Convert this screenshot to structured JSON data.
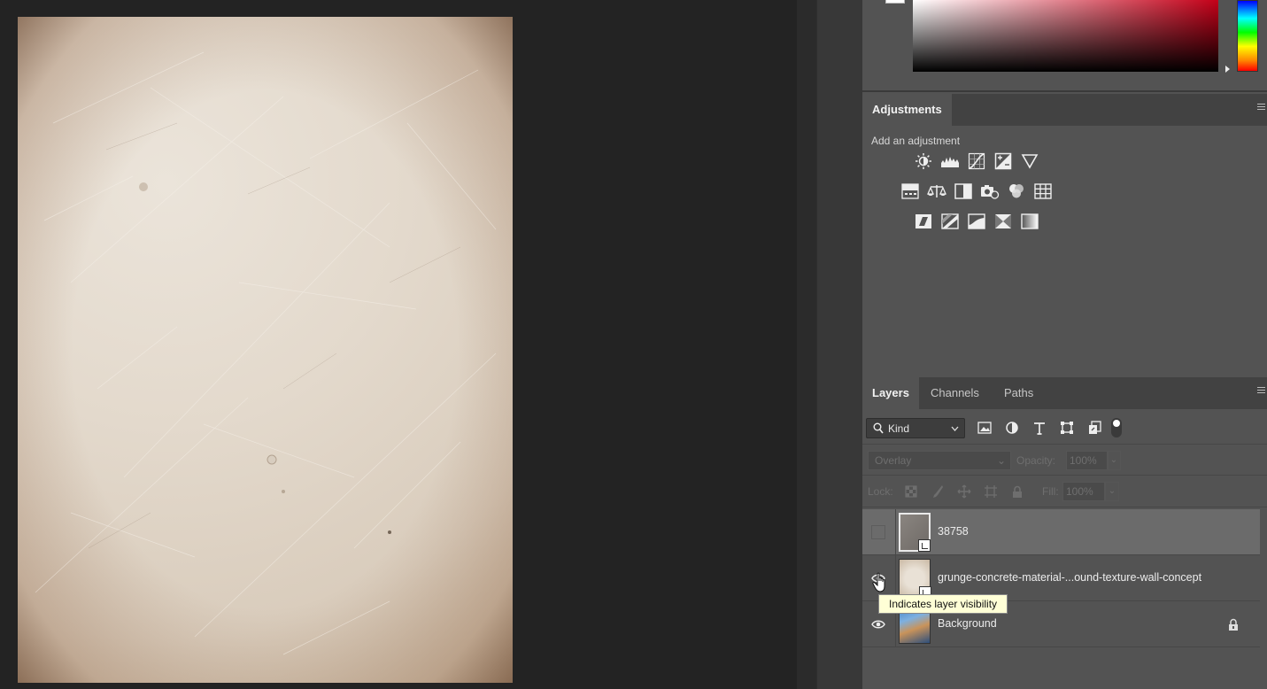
{
  "adjustments": {
    "tab_label": "Adjustments",
    "add_label": "Add an adjustment",
    "row1": [
      "brightness-contrast-icon",
      "levels-icon",
      "curves-icon",
      "exposure-icon",
      "vibrance-icon"
    ],
    "row2": [
      "hue-saturation-icon",
      "color-balance-icon",
      "black-white-icon",
      "photo-filter-icon",
      "channel-mixer-icon",
      "color-lookup-icon"
    ],
    "row3": [
      "invert-icon",
      "posterize-icon",
      "threshold-icon",
      "selective-color-icon",
      "gradient-map-icon"
    ]
  },
  "layers_panel": {
    "tabs": [
      {
        "label": "Layers",
        "active": true
      },
      {
        "label": "Channels",
        "active": false
      },
      {
        "label": "Paths",
        "active": false
      }
    ],
    "filter_kind": "Kind",
    "blend_mode": "Overlay",
    "opacity_label": "Opacity:",
    "opacity_value": "100%",
    "lock_label": "Lock:",
    "fill_label": "Fill:",
    "fill_value": "100%",
    "layers": [
      {
        "name": "38758",
        "visible": false,
        "selected": true
      },
      {
        "name": "grunge-concrete-material-...ound-texture-wall-concept",
        "visible": true,
        "selected": false
      },
      {
        "name": "Background",
        "visible": true,
        "selected": false,
        "locked": true
      }
    ]
  },
  "tooltip": {
    "text": "Indicates layer visibility"
  },
  "colors": {
    "app_background": "#232323",
    "panel_background": "#535353",
    "tab_bar": "#424242",
    "selected_layer": "#6b6b6b",
    "tooltip_background": "#ffffd6"
  }
}
